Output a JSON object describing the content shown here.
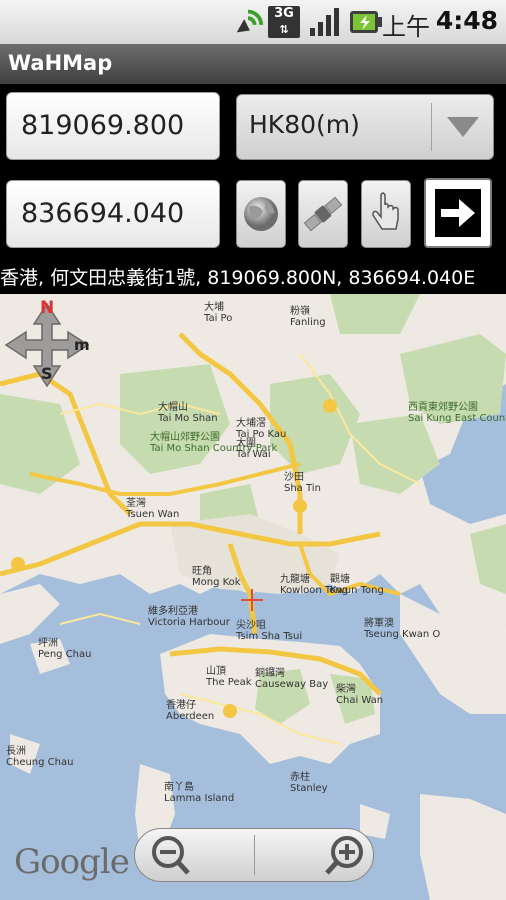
{
  "status_bar": {
    "network": "3G",
    "ampm": "上午",
    "time": "4:48",
    "icons": [
      "signal-antenna-icon",
      "3g-data-icon",
      "signal-bars-icon",
      "battery-charging-icon"
    ]
  },
  "app": {
    "title": "WaHMap"
  },
  "controls": {
    "easting_value": "819069.800",
    "northing_value": "836694.040",
    "datum_selected": "HK80(m)",
    "tools": [
      "globe-icon",
      "satellite-icon",
      "hand-pointer-icon",
      "arrow-right-icon"
    ]
  },
  "address": "香港, 何文田忠義街1號, 819069.800N, 836694.040E",
  "map": {
    "compass": {
      "n": "N",
      "s": "S",
      "m": "m"
    },
    "labels": [
      {
        "zh": "大帽山",
        "en": "Tai Mo Shan"
      },
      {
        "zh": "大帽山郊野公園",
        "en": "Tai Mo Shan Country Park"
      },
      {
        "zh": "大埔滘",
        "en": "Tai Po Kau"
      },
      {
        "zh": "大圍",
        "en": "Tai Wai"
      },
      {
        "zh": "沙田",
        "en": "Sha Tin"
      },
      {
        "zh": "荃灣",
        "en": "Tsuen Wan"
      },
      {
        "zh": "旺角",
        "en": "Mong Kok"
      },
      {
        "zh": "九龍塘",
        "en": "Kowloon Tong"
      },
      {
        "zh": "觀塘",
        "en": "Kwun Tong"
      },
      {
        "zh": "尖沙咀",
        "en": "Tsim Sha Tsui"
      },
      {
        "zh": "維多利亞港",
        "en": "Victoria Harbour"
      },
      {
        "zh": "銅鑼灣",
        "en": "Causeway Bay"
      },
      {
        "zh": "山頂",
        "en": "The Peak"
      },
      {
        "zh": "香港仔",
        "en": "Aberdeen"
      },
      {
        "zh": "柴灣",
        "en": "Chai Wan"
      },
      {
        "zh": "赤柱",
        "en": "Stanley"
      },
      {
        "zh": "南丫島",
        "en": "Lamma Island"
      },
      {
        "zh": "坪洲",
        "en": "Peng Chau"
      },
      {
        "zh": "長洲",
        "en": "Cheung Chau"
      },
      {
        "zh": "將軍澳",
        "en": "Tseung Kwan O"
      },
      {
        "zh": "西貢東郊野公園",
        "en": "Sai Kung East Country Park"
      },
      {
        "zh": "大埔",
        "en": "Tai Po"
      },
      {
        "zh": "粉嶺",
        "en": "Fanling"
      }
    ],
    "google_logo": "Google"
  },
  "colors": {
    "water": "#a4bedb",
    "land": "#eeeae3",
    "park": "#c6dbb0",
    "highway": "#f3c744",
    "road": "#fbe89c",
    "marker": "#e84a3a"
  }
}
